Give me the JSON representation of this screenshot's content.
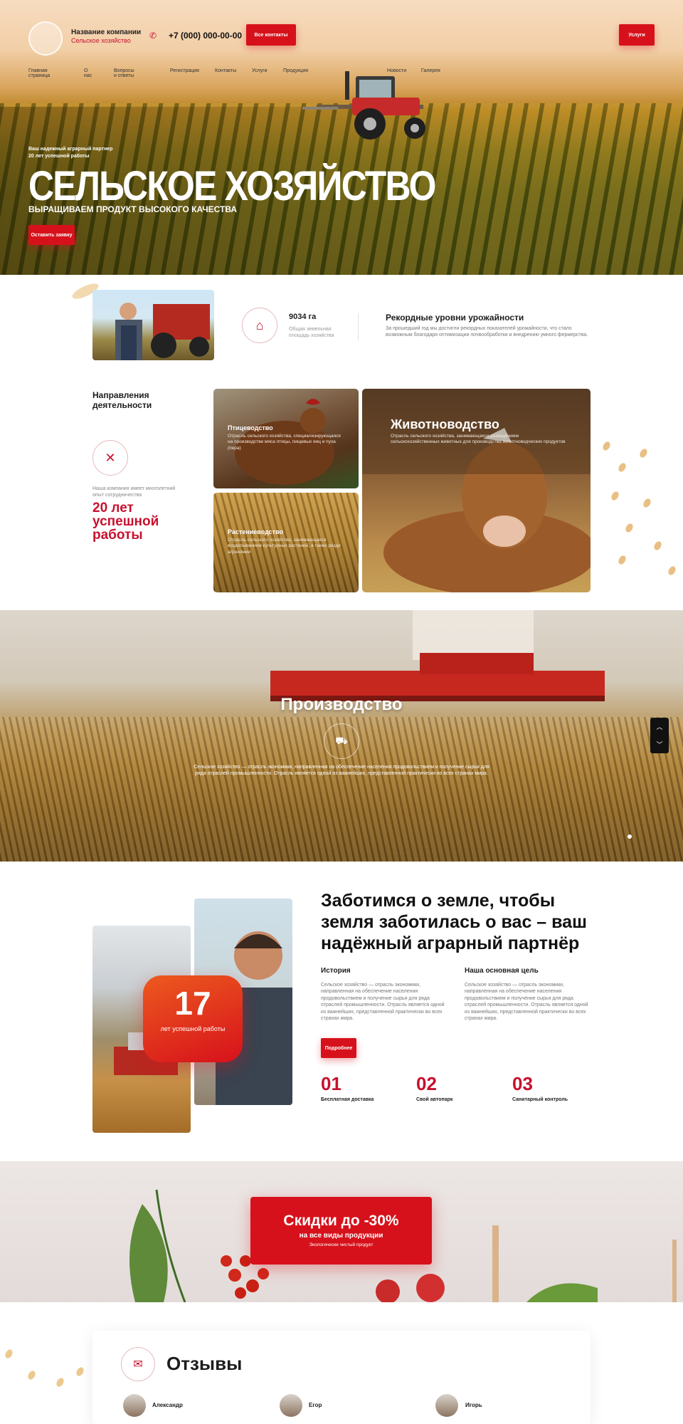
{
  "header": {
    "company_name": "Название компании",
    "company_sub": "Сельское хозяйство",
    "phone": "+7 (000) 000-00-00",
    "contacts_btn": "Все контакты",
    "services_btn": "Услуги"
  },
  "nav": [
    "Главная страница",
    "О нас",
    "Вопросы и ответы",
    "Регистрация",
    "Контакты",
    "Услуги",
    "Продукция",
    "Новости",
    "Галерея"
  ],
  "hero": {
    "tag1": "Ваш надежный аграрный партнер",
    "tag2": "20 лет успешной работы",
    "title": "СЕЛЬСКОЕ ХОЗЯЙСТВО",
    "subtitle": "ВЫРАЩИВАЕМ ПРОДУКТ ВЫСОКОГО КАЧЕСТВА",
    "cta": "Оставить заявку"
  },
  "stats": {
    "area_value": "9034 га",
    "area_label": "Общая земельная площадь хозяйства",
    "record_title": "Рекордные уровни урожайности",
    "record_text": "За прошедший год мы достигли рекордных показателей урожайности, что стало возможным благодаря оптимизации почвообработки и внедрению умного фермерства."
  },
  "directions": {
    "title": "Направления деятельности",
    "experience_text": "Наша компания имеет многолетний опыт сотрудничества",
    "years_text": "20 лет успешной работы",
    "cards": [
      {
        "title": "Птицеводство",
        "text": "Отрасль сельского хозяйства, специализирующаяся на производстве мяса птицы, пищевых яиц и пуха (пера)"
      },
      {
        "title": "Растениеводство",
        "text": "Отрасль сельского хозяйства, занимающаяся возделыванием культурных растений, а также разде агрономии"
      },
      {
        "title": "Животноводство",
        "text": "Отрасль сельского хозяйства, занимающаяся разведением сельскохозяйственных животных для производства животноводческих продуктов"
      }
    ]
  },
  "production": {
    "title": "Производство",
    "text": "Сельское хозяйство — отрасль экономики, направленная на обеспечение населения продовольствием и получение сырья для ряда отраслей промышленности. Отрасль является одной из важнейших, представленной практически во всех странах мира."
  },
  "about": {
    "heading": "Заботимся о земле, чтобы земля заботилась о вас – ваш надёжный аграрный партнёр",
    "badge_number": "17",
    "badge_label": "лет успешной работы",
    "history_title": "История",
    "history_text": "Сельское хозяйство — отрасль экономики, направленная на обеспечение населения продовольствием и получение сырья для ряда отраслей промышленности. Отрасль является одной из важнейших, представленной практически во всех странах мира.",
    "goal_title": "Наша основная цель",
    "goal_text": "Сельское хозяйство — отрасль экономики, направленная на обеспечение населения продовольствием и получение сырья для ряда отраслей промышленности. Отрасль является одной из важнейших, представленной практически во всех странах мира.",
    "more_btn": "Подробнее",
    "features": [
      {
        "num": "01",
        "label": "Бесплатная доставка"
      },
      {
        "num": "02",
        "label": "Свой автопарк"
      },
      {
        "num": "03",
        "label": "Санитарный контроль"
      }
    ]
  },
  "sale": {
    "title": "Скидки до -30%",
    "subtitle": "на все виды продукции",
    "note": "Экологически чистый продукт"
  },
  "reviews": {
    "title": "Отзывы",
    "people": [
      "Александр",
      "Егор",
      "Игорь"
    ]
  }
}
